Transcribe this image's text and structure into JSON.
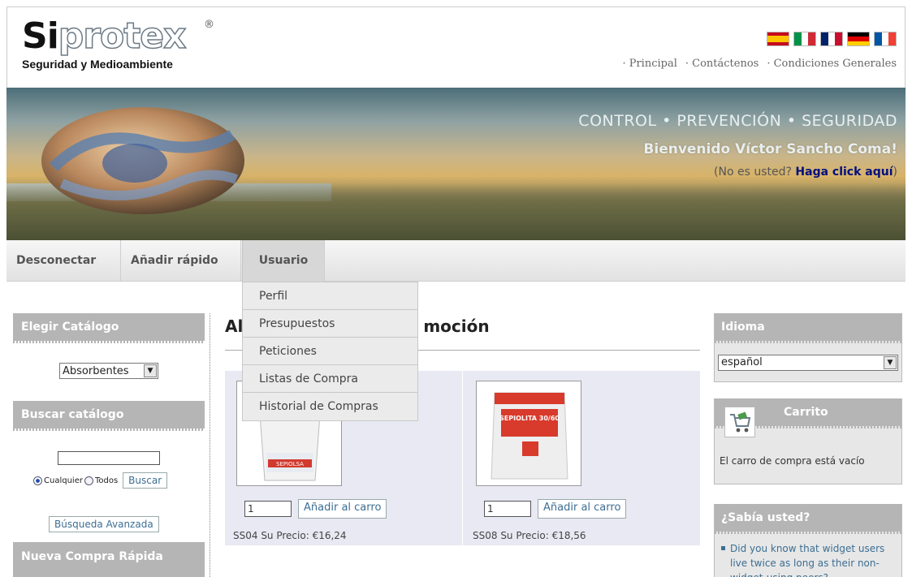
{
  "header": {
    "logo_si": "Si",
    "logo_rest": "protex",
    "logo_reg": "®",
    "tagline": "Seguridad y Medioambiente",
    "flags": [
      {
        "name": "es-flag",
        "colors": [
          "#c60b1e",
          "#ffc400",
          "#c60b1e"
        ]
      },
      {
        "name": "it-flag",
        "colors": [
          "#009246",
          "#ffffff",
          "#ce2b37"
        ]
      },
      {
        "name": "uk-flag",
        "colors": [
          "#012169",
          "#ffffff",
          "#c8102e"
        ]
      },
      {
        "name": "de-flag",
        "colors": [
          "#000000",
          "#dd0000",
          "#ffce00"
        ]
      },
      {
        "name": "fr-flag",
        "colors": [
          "#0055a4",
          "#ffffff",
          "#ef4135"
        ]
      }
    ],
    "links": [
      "· Principal",
      "· Contáctenos",
      "· Condiciones Generales"
    ]
  },
  "banner": {
    "slogan": "CONTROL • PREVENCIÓN • SEGURIDAD",
    "welcome": "Bienvenido Víctor Sancho Coma!",
    "not_you": "(No es usted?",
    "click_here": "Haga click aquí",
    "close_paren": ")"
  },
  "menu": {
    "items": [
      "Desconectar",
      "Añadir rápido",
      "Usuario"
    ],
    "dropdown": [
      "Perfil",
      "Presupuestos",
      "Peticiones",
      "Listas de Compra",
      "Historial de Compras"
    ]
  },
  "left": {
    "catalog_head": "Elegir Catálogo",
    "catalog_value": "Absorbentes",
    "search_head": "Buscar catálogo",
    "search_value": "",
    "radio_any": "Cualquier",
    "radio_all": "Todos",
    "search_button": "Buscar",
    "advanced_button": "Búsqueda Avanzada",
    "new_purchase_head": "Nueva Compra Rápida"
  },
  "main": {
    "title_left": "Al",
    "title_right": "moción",
    "products": [
      {
        "qty": "1",
        "add": "Añadir al carro",
        "price": "SS04 Su Precio: €16,24",
        "img_label": "SEPIOLSA"
      },
      {
        "qty": "1",
        "add": "Añadir al carro",
        "price": "SS08 Su Precio: €18,56",
        "img_label": "SEPIOLITA 30/60"
      }
    ]
  },
  "right": {
    "language_head": "Idioma",
    "language_value": "español",
    "cart_head": "Carrito",
    "cart_empty": "El carro de compra está vacío",
    "did_you_know_head": "¿Sabía usted?",
    "did_you_know_text": "Did you know that widget users live twice as long as their non-widget-using peers?"
  }
}
